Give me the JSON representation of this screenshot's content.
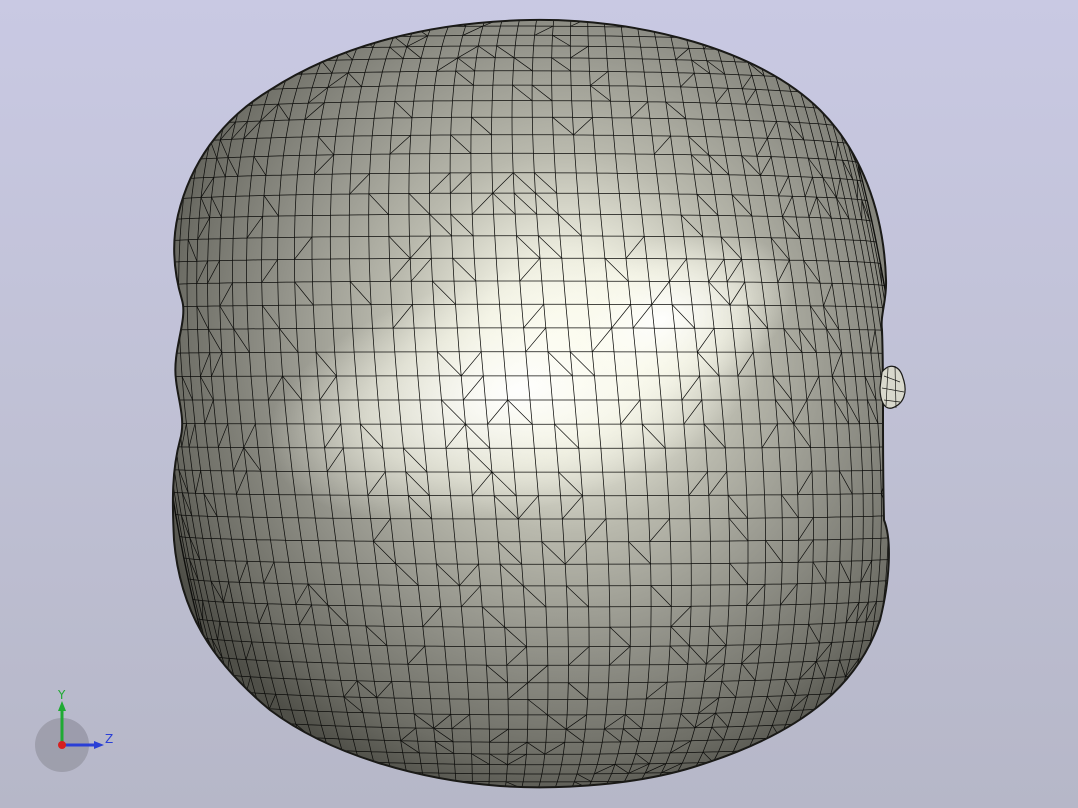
{
  "viewport": {
    "background_top": "#c9c9e3",
    "background_bottom": "#b6b7c8",
    "model": {
      "shape": "apple",
      "display_mode": "shaded-with-mesh-edges",
      "surface_color_light": "#fbfbf0",
      "surface_color_dark": "#4f4f48",
      "edge_color": "#000000"
    }
  },
  "triad": {
    "y_label": "Y",
    "z_label": "Z",
    "y_color": "#1faa33",
    "z_color": "#2a3fd6",
    "x_color": "#d62020"
  }
}
